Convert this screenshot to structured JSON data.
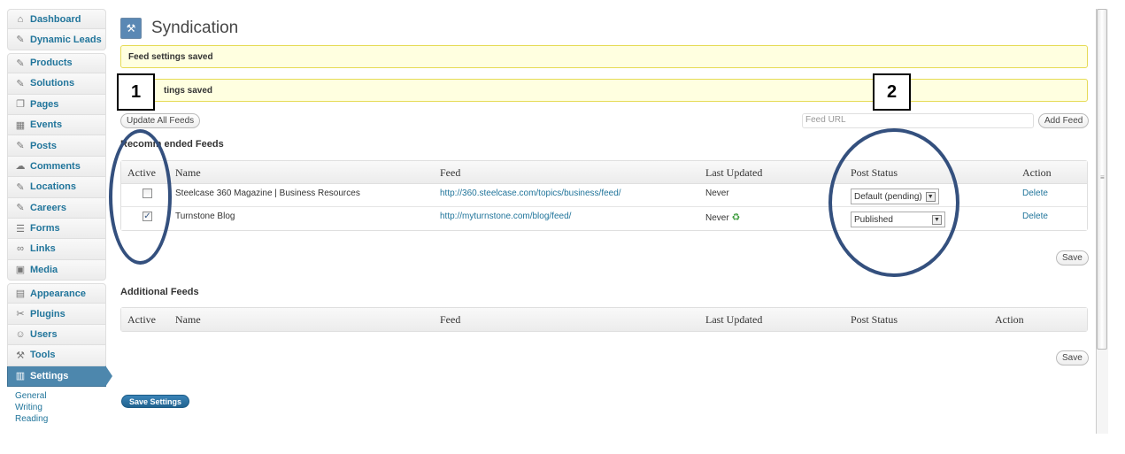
{
  "sidebar": {
    "items": [
      {
        "label": "Dashboard",
        "icon": "⌂"
      },
      {
        "label": "Dynamic Leads",
        "icon": "✎"
      },
      {
        "label": "Products",
        "icon": "✎"
      },
      {
        "label": "Solutions",
        "icon": "✎"
      },
      {
        "label": "Pages",
        "icon": "❐"
      },
      {
        "label": "Events",
        "icon": "▦"
      },
      {
        "label": "Posts",
        "icon": "✎"
      },
      {
        "label": "Comments",
        "icon": "☁"
      },
      {
        "label": "Locations",
        "icon": "✎"
      },
      {
        "label": "Careers",
        "icon": "✎"
      },
      {
        "label": "Forms",
        "icon": "☰"
      },
      {
        "label": "Links",
        "icon": "∞"
      },
      {
        "label": "Media",
        "icon": "▣"
      },
      {
        "label": "Appearance",
        "icon": "▤"
      },
      {
        "label": "Plugins",
        "icon": "✂"
      },
      {
        "label": "Users",
        "icon": "☺"
      },
      {
        "label": "Tools",
        "icon": "⚒"
      },
      {
        "label": "Settings",
        "icon": "▥"
      }
    ],
    "submenu": [
      "General",
      "Writing",
      "Reading"
    ]
  },
  "page": {
    "title": "Syndication",
    "title_icon": "⚒",
    "notice1": "Feed settings saved",
    "notice2": "tings saved",
    "update_all_label": "Update All Feeds",
    "feed_url_placeholder": "Feed URL",
    "add_feed_label": "Add Feed",
    "save_label": "Save",
    "save_settings_label": "Save Settings"
  },
  "recommended": {
    "title": "Recomm",
    "title_rest": "ended Feeds",
    "headers": {
      "active": "Active",
      "name": "Name",
      "feed": "Feed",
      "last_updated": "Last Updated",
      "post_status": "Post Status",
      "action": "Action"
    },
    "rows": [
      {
        "checked": "",
        "name": "Steelcase 360 Magazine | Business Resources",
        "feed": "http://360.steelcase.com/topics/business/feed/",
        "last_updated": "Never",
        "status": "Default (pending)",
        "action": "Delete"
      },
      {
        "checked": "✓",
        "name": "Turnstone Blog",
        "feed": "http://myturnstone.com/blog/feed/",
        "last_updated": "Never",
        "status": "Published",
        "action": "Delete"
      }
    ]
  },
  "additional": {
    "title": "Additional Feeds",
    "headers": {
      "active": "Active",
      "name": "Name",
      "feed": "Feed",
      "last_updated": "Last Updated",
      "post_status": "Post Status",
      "action": "Action"
    }
  },
  "annotations": {
    "one": "1",
    "two": "2"
  },
  "colors": {
    "accent": "#21759b",
    "annotation": "#34507e",
    "notice_bg": "#ffffe0"
  }
}
